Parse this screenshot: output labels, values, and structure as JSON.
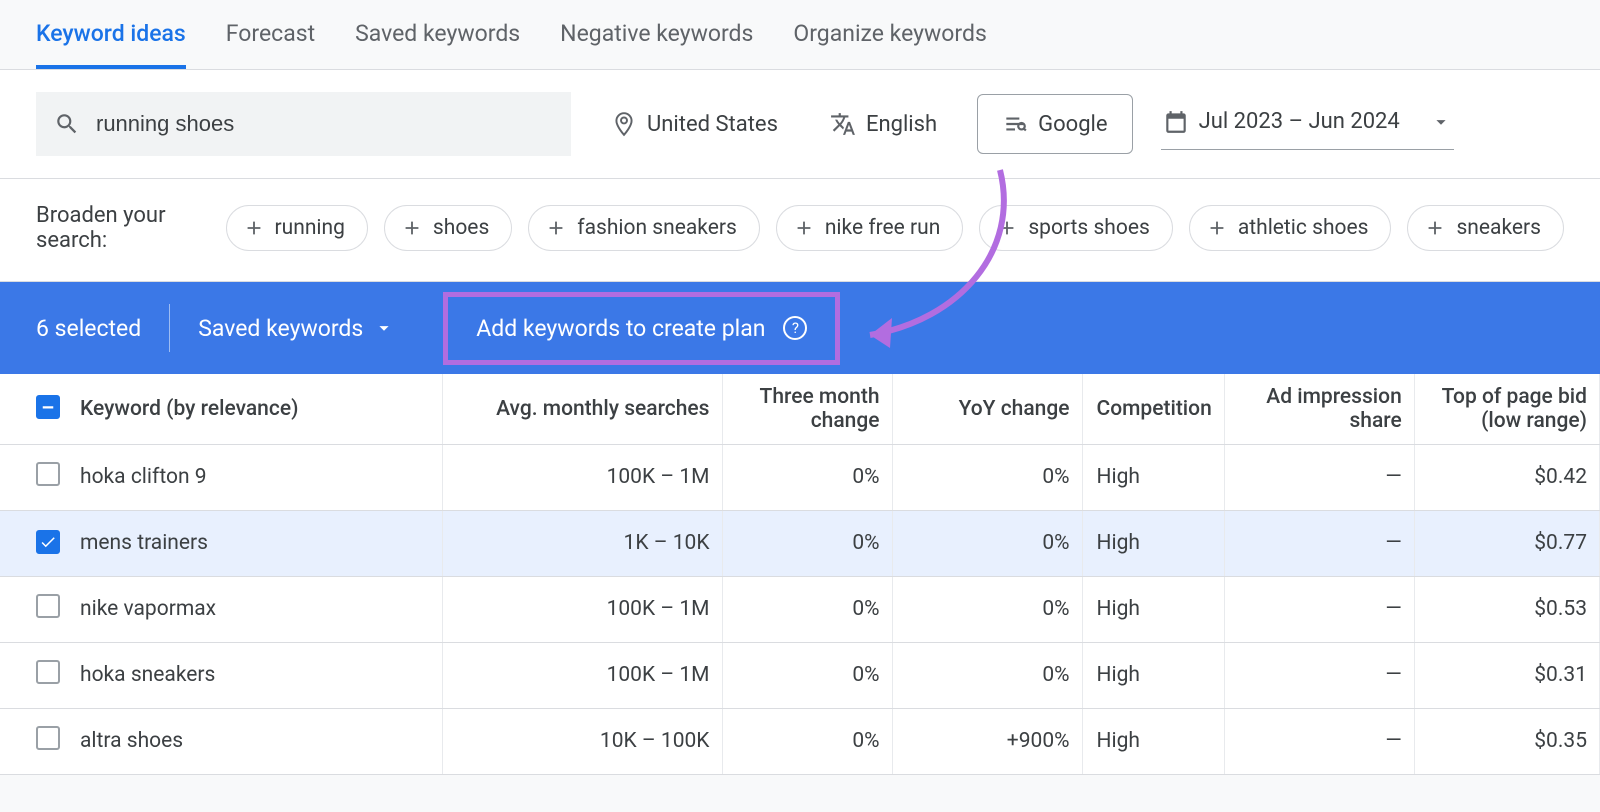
{
  "tabs": {
    "keyword_ideas": "Keyword ideas",
    "forecast": "Forecast",
    "saved_keywords": "Saved keywords",
    "negative_keywords": "Negative keywords",
    "organize_keywords": "Organize keywords"
  },
  "filters": {
    "search_value": "running shoes",
    "location": "United States",
    "language": "English",
    "network": "Google",
    "date_range": "Jul 2023 – Jun 2024"
  },
  "broaden": {
    "label": "Broaden your search:",
    "chips": [
      "running",
      "shoes",
      "fashion sneakers",
      "nike free run",
      "sports shoes",
      "athletic shoes",
      "sneakers"
    ]
  },
  "selection_bar": {
    "count_label": "6 selected",
    "saved_label": "Saved keywords",
    "create_plan_label": "Add keywords to create plan"
  },
  "columns": {
    "keyword": "Keyword (by relevance)",
    "avg_searches": "Avg. monthly searches",
    "three_month": "Three month change",
    "yoy": "YoY change",
    "competition": "Competition",
    "ad_share": "Ad impression share",
    "top_bid_low": "Top of page bid (low range)"
  },
  "rows": [
    {
      "checked": false,
      "keyword": "hoka clifton 9",
      "avg": "100K – 1M",
      "three_m": "0%",
      "yoy": "0%",
      "comp": "High",
      "ad_share": "—",
      "bid": "$0.42"
    },
    {
      "checked": true,
      "keyword": "mens trainers",
      "avg": "1K – 10K",
      "three_m": "0%",
      "yoy": "0%",
      "comp": "High",
      "ad_share": "—",
      "bid": "$0.77"
    },
    {
      "checked": false,
      "keyword": "nike vapormax",
      "avg": "100K – 1M",
      "three_m": "0%",
      "yoy": "0%",
      "comp": "High",
      "ad_share": "—",
      "bid": "$0.53"
    },
    {
      "checked": false,
      "keyword": "hoka sneakers",
      "avg": "100K – 1M",
      "three_m": "0%",
      "yoy": "0%",
      "comp": "High",
      "ad_share": "—",
      "bid": "$0.31"
    },
    {
      "checked": false,
      "keyword": "altra shoes",
      "avg": "10K – 100K",
      "three_m": "0%",
      "yoy": "+900%",
      "comp": "High",
      "ad_share": "—",
      "bid": "$0.35"
    }
  ]
}
